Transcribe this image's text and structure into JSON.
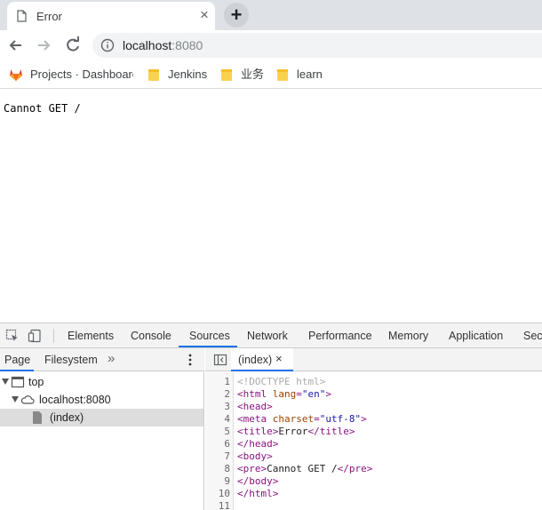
{
  "tab": {
    "title": "Error",
    "close": "×",
    "new_tab": "+"
  },
  "toolbar": {
    "url_host": "localhost",
    "url_port": ":8080"
  },
  "bookmarks": [
    {
      "label": "Projects · Dashboard",
      "icon": "gitlab-icon"
    },
    {
      "label": "Jenkins",
      "icon": "folder-icon"
    },
    {
      "label": "业务",
      "icon": "folder-icon"
    },
    {
      "label": "learn",
      "icon": "folder-icon"
    }
  ],
  "page": {
    "body_text": "Cannot GET /"
  },
  "devtools": {
    "tabs": [
      "Elements",
      "Console",
      "Sources",
      "Network",
      "Performance",
      "Memory",
      "Application",
      "Security"
    ],
    "active_tab": "Sources",
    "navigator_tabs": [
      "Page",
      "Filesystem"
    ],
    "more": "»",
    "tree": [
      "top",
      "localhost:8080",
      "(index)"
    ],
    "open_file": "(index)",
    "open_file_close": "×",
    "code_lines": [
      {
        "n": "1",
        "parts": [
          [
            "doctype",
            "<!DOCTYPE html>"
          ]
        ]
      },
      {
        "n": "2",
        "parts": [
          [
            "tag",
            "<html "
          ],
          [
            "attr",
            "lang"
          ],
          [
            "tag",
            "="
          ],
          [
            "val",
            "\"en\""
          ],
          [
            "tag",
            ">"
          ]
        ]
      },
      {
        "n": "3",
        "parts": [
          [
            "tag",
            "<head>"
          ]
        ]
      },
      {
        "n": "4",
        "parts": [
          [
            "tag",
            "<meta "
          ],
          [
            "attr",
            "charset"
          ],
          [
            "tag",
            "="
          ],
          [
            "val",
            "\"utf-8\""
          ],
          [
            "tag",
            ">"
          ]
        ]
      },
      {
        "n": "5",
        "parts": [
          [
            "tag",
            "<title>"
          ],
          [
            "text",
            "Error"
          ],
          [
            "tag",
            "</title>"
          ]
        ]
      },
      {
        "n": "6",
        "parts": [
          [
            "tag",
            "</head>"
          ]
        ]
      },
      {
        "n": "7",
        "parts": [
          [
            "tag",
            "<body>"
          ]
        ]
      },
      {
        "n": "8",
        "parts": [
          [
            "tag",
            "<pre>"
          ],
          [
            "text",
            "Cannot GET /"
          ],
          [
            "tag",
            "</pre>"
          ]
        ]
      },
      {
        "n": "9",
        "parts": [
          [
            "tag",
            "</body>"
          ]
        ]
      },
      {
        "n": "10",
        "parts": [
          [
            "tag",
            "</html>"
          ]
        ]
      },
      {
        "n": "11",
        "parts": []
      }
    ]
  },
  "colors": {
    "accent": "#1a73e8",
    "tag": "#881280",
    "attr": "#994500",
    "value": "#1a1aa6"
  }
}
